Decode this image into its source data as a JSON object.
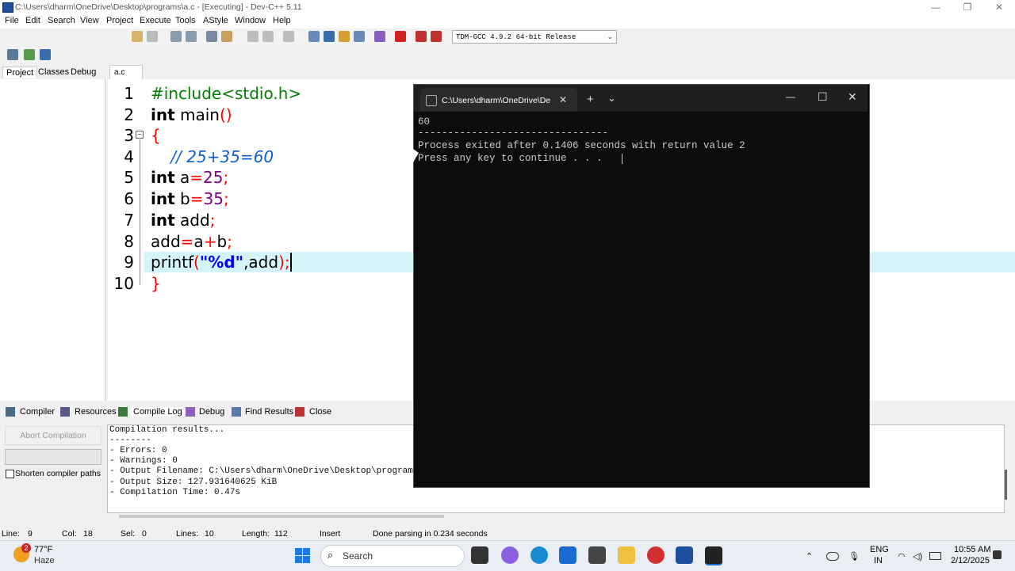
{
  "window": {
    "title": "C:\\Users\\dharm\\OneDrive\\Desktop\\programs\\a.c - [Executing] - Dev-C++ 5.11",
    "minimize": "—",
    "maximize": "❐",
    "close": "✕"
  },
  "menu": [
    "File",
    "Edit",
    "Search",
    "View",
    "Project",
    "Execute",
    "Tools",
    "AStyle",
    "Window",
    "Help"
  ],
  "toolbar": {
    "compiler": "TDM-GCC 4.9.2 64-bit Release"
  },
  "left_tabs": [
    "Project",
    "Classes",
    "Debug"
  ],
  "editor": {
    "tab": "a.c",
    "line_numbers": [
      "1",
      "2",
      "3",
      "4",
      "5",
      "6",
      "7",
      "8",
      "9",
      "10"
    ],
    "code": {
      "l1": "#include<stdio.h>",
      "l2_kw": "int",
      "l2_rest": " main",
      "l2_paren": "()",
      "l3": "{",
      "l4": "    // 25+35=60",
      "l5_kw": "int",
      "l5_var": " a",
      "l5_eq": "=",
      "l5_num": "25",
      "l5_semi": ";",
      "l6_kw": "int",
      "l6_var": " b",
      "l6_eq": "=",
      "l6_num": "35",
      "l6_semi": ";",
      "l7_kw": "int",
      "l7_var": " add",
      "l7_semi": ";",
      "l8_a": "add",
      "l8_eq": "=",
      "l8_b": "a",
      "l8_plus": "+",
      "l8_c": "b",
      "l8_semi": ";",
      "l9_fn": "printf",
      "l9_open": "(",
      "l9_str": "\"%d\"",
      "l9_rest": ",add",
      "l9_close": ");",
      "l10": "}"
    }
  },
  "bottom_tabs": [
    "Compiler",
    "Resources",
    "Compile Log",
    "Debug",
    "Find Results",
    "Close"
  ],
  "bottom": {
    "abort": "Abort Compilation",
    "shorten": "Shorten compiler paths",
    "log": [
      "Compilation results...",
      "--------",
      "- Errors: 0",
      "- Warnings: 0",
      "- Output Filename: C:\\Users\\dharm\\OneDrive\\Desktop\\program",
      "- Output Size: 127.931640625 KiB",
      "- Compilation Time: 0.47s"
    ]
  },
  "status": {
    "line_label": "Line:",
    "line": "9",
    "col_label": "Col:",
    "col": "18",
    "sel_label": "Sel:",
    "sel": "0",
    "lines_label": "Lines:",
    "lines": "10",
    "length_label": "Length:",
    "length": "112",
    "mode": "Insert",
    "message": "Done parsing in 0.234 seconds"
  },
  "console": {
    "tab_title": "C:\\Users\\dharm\\OneDrive\\De",
    "tab_close": "✕",
    "new_tab": "+",
    "dropdown": "⌄",
    "minimize": "—",
    "maximize": "☐",
    "close": "✕",
    "output": [
      "60",
      "--------------------------------",
      "Process exited after 0.1406 seconds with return value 2",
      "Press any key to continue . . . "
    ]
  },
  "taskbar": {
    "weather_temp": "77°F",
    "weather_desc": "Haze",
    "weather_badge": "2",
    "search": "Search",
    "lang1": "ENG",
    "lang2": "IN",
    "time": "10:55 AM",
    "date": "2/12/2025"
  }
}
